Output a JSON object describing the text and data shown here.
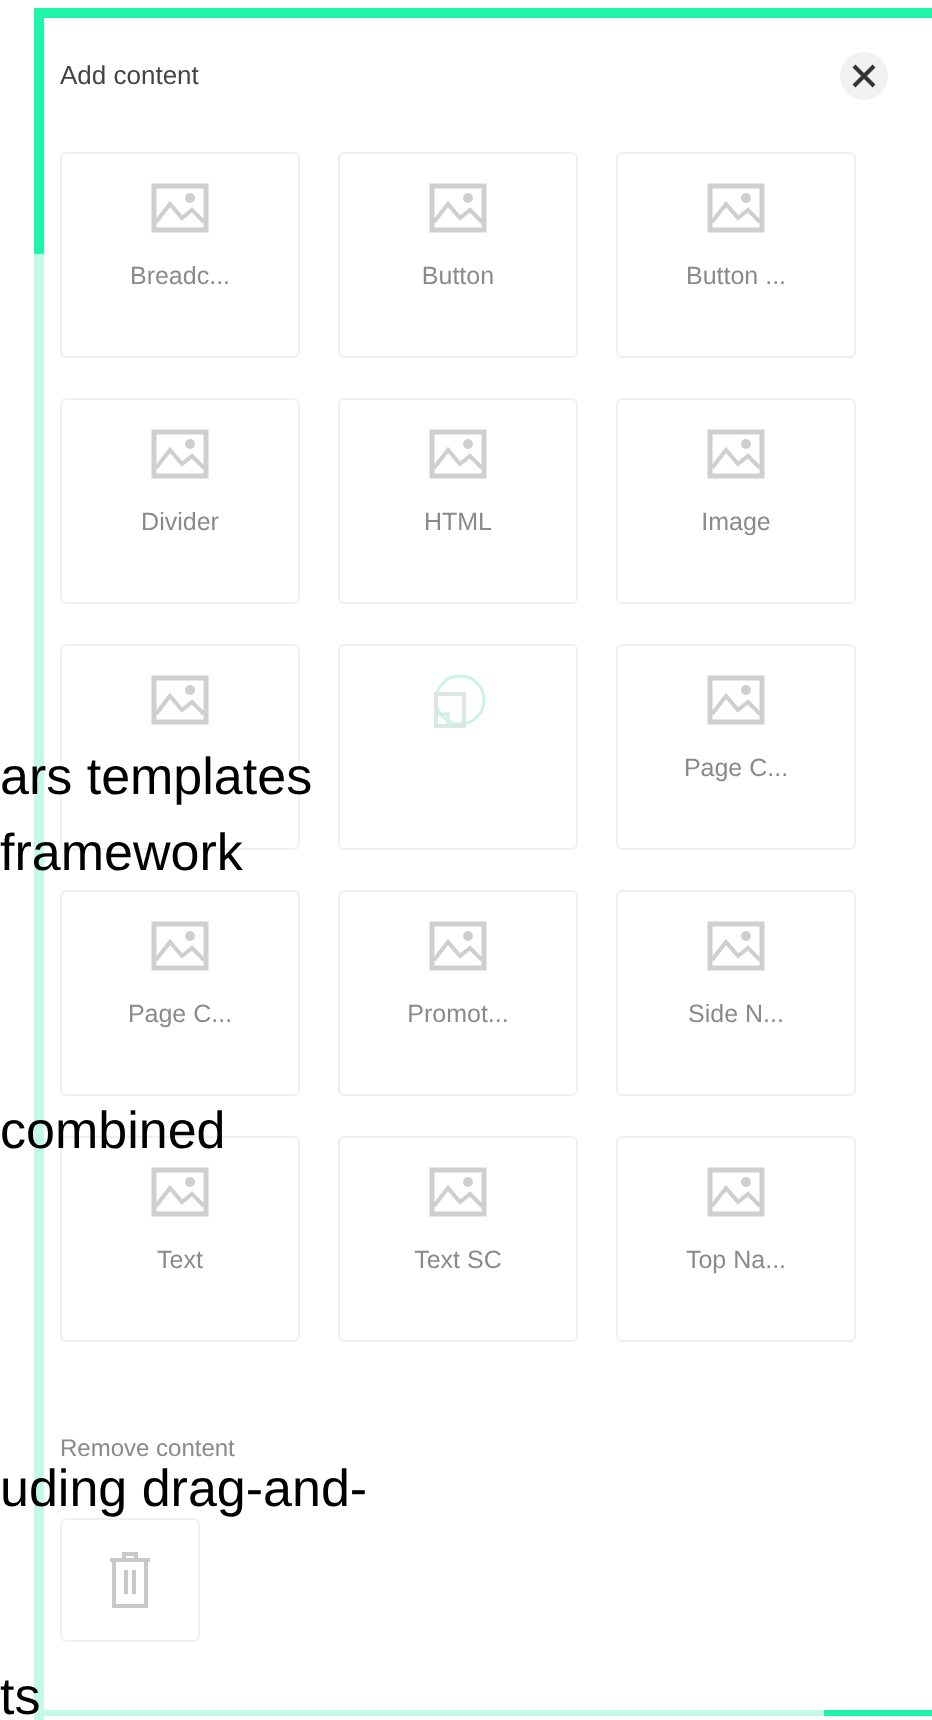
{
  "panel": {
    "title": "Add content",
    "tiles": [
      {
        "kind": "image",
        "label": "Breadc..."
      },
      {
        "kind": "image",
        "label": "Button"
      },
      {
        "kind": "image",
        "label": "Button ..."
      },
      {
        "kind": "image",
        "label": "Divider"
      },
      {
        "kind": "image",
        "label": "HTML"
      },
      {
        "kind": "image",
        "label": "Image"
      },
      {
        "kind": "image"
      },
      {
        "kind": "component"
      },
      {
        "kind": "image",
        "label": "Page C..."
      },
      {
        "kind": "image",
        "label": "Page C..."
      },
      {
        "kind": "image",
        "label": "Promot..."
      },
      {
        "kind": "image",
        "label": "Side N..."
      },
      {
        "kind": "image",
        "label": "Text"
      },
      {
        "kind": "image",
        "label": "Text SC"
      },
      {
        "kind": "image",
        "label": "Top Na..."
      }
    ],
    "remove_label": "Remove content"
  },
  "slide_text": [
    "ars templates",
    "framework",
    "combined",
    "uding drag-and-",
    "ts"
  ]
}
